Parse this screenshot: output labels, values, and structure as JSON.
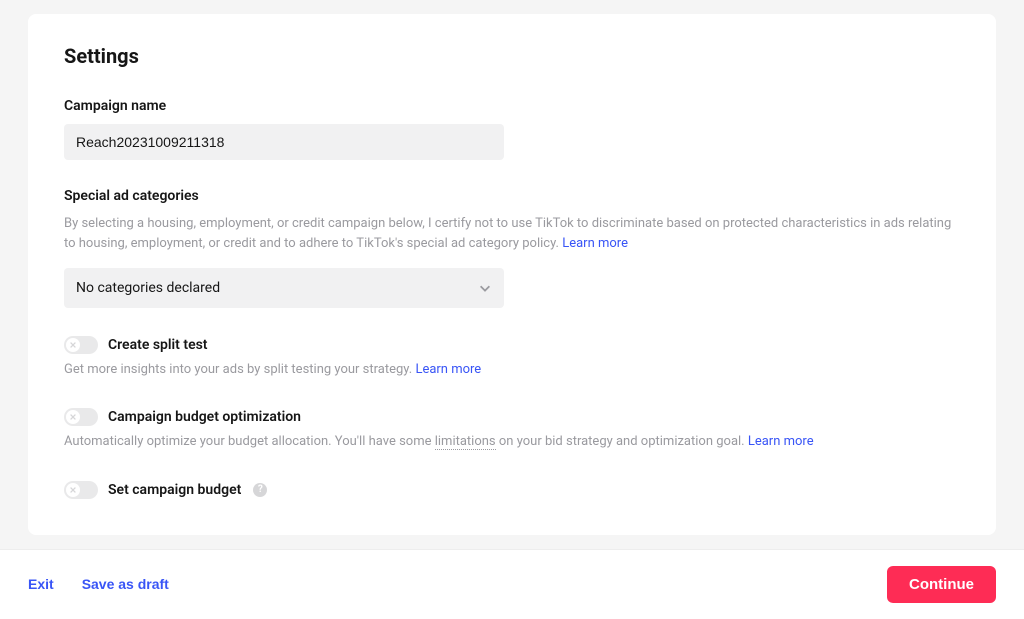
{
  "page": {
    "title": "Settings"
  },
  "campaign_name": {
    "label": "Campaign name",
    "value": "Reach20231009211318"
  },
  "special_categories": {
    "label": "Special ad categories",
    "description": "By selecting a housing, employment, or credit campaign below, I certify not to use TikTok to discriminate based on protected characteristics in ads relating to housing, employment, or credit and to adhere to TikTok's special ad category policy. ",
    "learn_more": "Learn more",
    "selected": "No categories declared"
  },
  "split_test": {
    "label": "Create split test",
    "description": "Get more insights into your ads by split testing your strategy.",
    "learn_more": "Learn more",
    "enabled": false
  },
  "budget_optimization": {
    "label": "Campaign budget optimization",
    "description_pre": "Automatically optimize your budget allocation. You'll have some ",
    "limitations": "limitations",
    "description_post": " on your bid strategy and optimization goal. ",
    "learn_more": "Learn more",
    "enabled": false
  },
  "campaign_budget": {
    "label": "Set campaign budget",
    "enabled": false
  },
  "footer": {
    "exit": "Exit",
    "save_draft": "Save as draft",
    "continue": "Continue"
  }
}
